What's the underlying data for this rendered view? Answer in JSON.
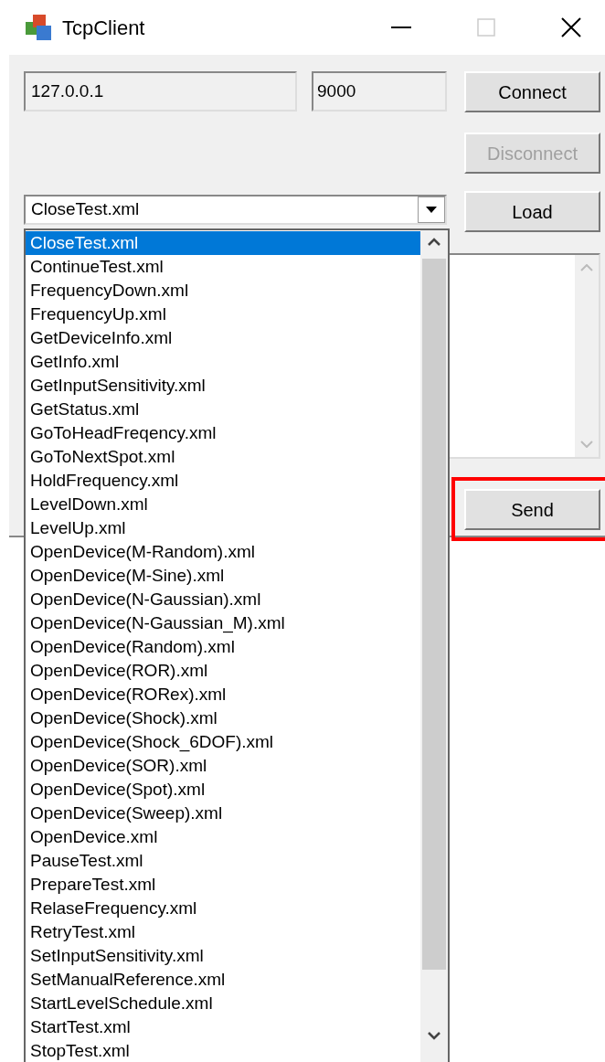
{
  "window": {
    "title": "TcpClient"
  },
  "host_field": {
    "value": "127.0.0.1"
  },
  "port_field": {
    "value": "9000"
  },
  "buttons": [
    {
      "label": "Connect",
      "disabled": false
    },
    {
      "label": "Disconnect",
      "disabled": true
    },
    {
      "label": "Load",
      "disabled": false
    },
    {
      "label": "Send",
      "disabled": false,
      "highlighted": true
    }
  ],
  "file_combo": {
    "value": "CloseTest.xml",
    "expanded": true
  },
  "dropdown": {
    "items": [
      {
        "label": "CloseTest.xml",
        "selected": true
      },
      {
        "label": "ContinueTest.xml",
        "selected": false
      },
      {
        "label": "FrequencyDown.xml",
        "selected": false
      },
      {
        "label": "FrequencyUp.xml",
        "selected": false
      },
      {
        "label": "GetDeviceInfo.xml",
        "selected": false
      },
      {
        "label": "GetInfo.xml",
        "selected": false
      },
      {
        "label": "GetInputSensitivity.xml",
        "selected": false
      },
      {
        "label": "GetStatus.xml",
        "selected": false
      },
      {
        "label": "GoToHeadFreqency.xml",
        "selected": false
      },
      {
        "label": "GoToNextSpot.xml",
        "selected": false
      },
      {
        "label": "HoldFrequency.xml",
        "selected": false
      },
      {
        "label": "LevelDown.xml",
        "selected": false
      },
      {
        "label": "LevelUp.xml",
        "selected": false
      },
      {
        "label": "OpenDevice(M-Random).xml",
        "selected": false
      },
      {
        "label": "OpenDevice(M-Sine).xml",
        "selected": false
      },
      {
        "label": "OpenDevice(N-Gaussian).xml",
        "selected": false
      },
      {
        "label": "OpenDevice(N-Gaussian_M).xml",
        "selected": false
      },
      {
        "label": "OpenDevice(Random).xml",
        "selected": false
      },
      {
        "label": "OpenDevice(ROR).xml",
        "selected": false
      },
      {
        "label": "OpenDevice(RORex).xml",
        "selected": false
      },
      {
        "label": "OpenDevice(Shock).xml",
        "selected": false
      },
      {
        "label": "OpenDevice(Shock_6DOF).xml",
        "selected": false
      },
      {
        "label": "OpenDevice(SOR).xml",
        "selected": false
      },
      {
        "label": "OpenDevice(Spot).xml",
        "selected": false
      },
      {
        "label": "OpenDevice(Sweep).xml",
        "selected": false
      },
      {
        "label": "OpenDevice.xml",
        "selected": false
      },
      {
        "label": "PauseTest.xml",
        "selected": false
      },
      {
        "label": "PrepareTest.xml",
        "selected": false
      },
      {
        "label": "RelaseFrequency.xml",
        "selected": false
      },
      {
        "label": "RetryTest.xml",
        "selected": false
      },
      {
        "label": "SetInputSensitivity.xml",
        "selected": false
      },
      {
        "label": "SetManualReference.xml",
        "selected": false
      },
      {
        "label": "StartLevelSchedule.xml",
        "selected": false
      },
      {
        "label": "StartTest.xml",
        "selected": false
      },
      {
        "label": "StopTest.xml",
        "selected": false
      }
    ]
  }
}
